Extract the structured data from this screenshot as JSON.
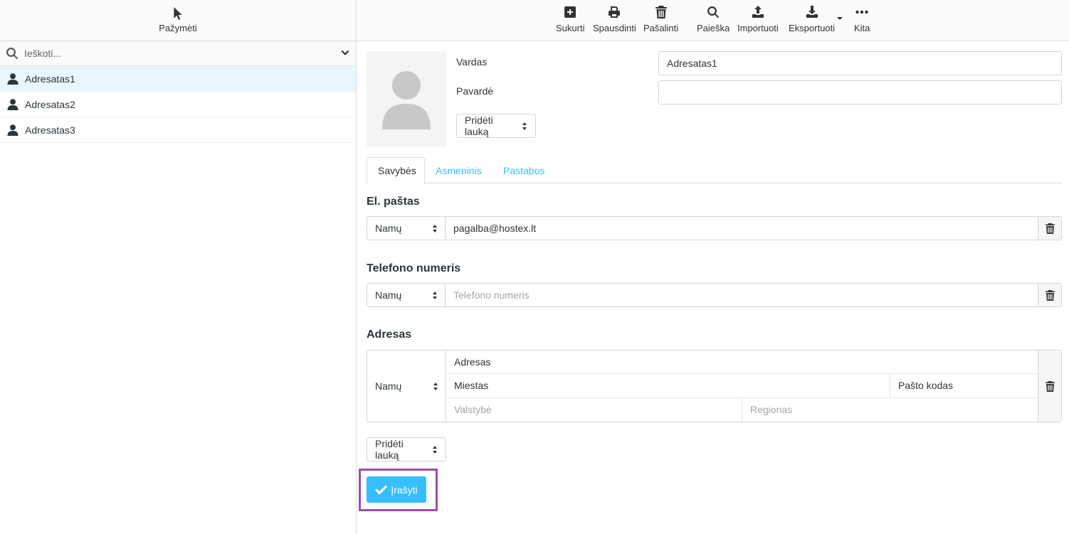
{
  "left_toolbar": {
    "select_label": "Pažymėti"
  },
  "search": {
    "placeholder": "Ieškoti..."
  },
  "contacts": [
    {
      "name": "Adresatas1",
      "selected": true
    },
    {
      "name": "Adresatas2"
    },
    {
      "name": "Adresatas3"
    }
  ],
  "toolbar": {
    "create": "Sukurti",
    "print": "Spausdinti",
    "delete": "Pašalinti",
    "search": "Paieška",
    "import": "Importuoti",
    "export": "Eksportuoti",
    "more": "Kita"
  },
  "form": {
    "first_name_label": "Vardas",
    "first_name_value": "Adresatas1",
    "last_name_label": "Pavardė",
    "last_name_value": "",
    "add_field_label": "Pridėti lauką",
    "tabs": [
      "Savybės",
      "Asmeninis",
      "Pastabos"
    ],
    "active_tab": "Savybės",
    "email": {
      "title": "El. paštas",
      "type": "Namų",
      "value": "pagalba@hostex.lt"
    },
    "phone": {
      "title": "Telefono numeris",
      "type": "Namų",
      "placeholder": "Telefono numeris"
    },
    "address": {
      "title": "Adresas",
      "type": "Namų",
      "street": "Adresas",
      "city": "Miestas",
      "postal_code": "Pašto kodas",
      "country_placeholder": "Valstybė",
      "region_placeholder": "Regionas"
    },
    "add_field_bottom_label": "Pridėti lauką",
    "save_label": "Įrašyti"
  },
  "colors": {
    "accent": "#37beff",
    "highlight_frame": "#9b4fa5",
    "selected_row": "#eaf6fd"
  }
}
